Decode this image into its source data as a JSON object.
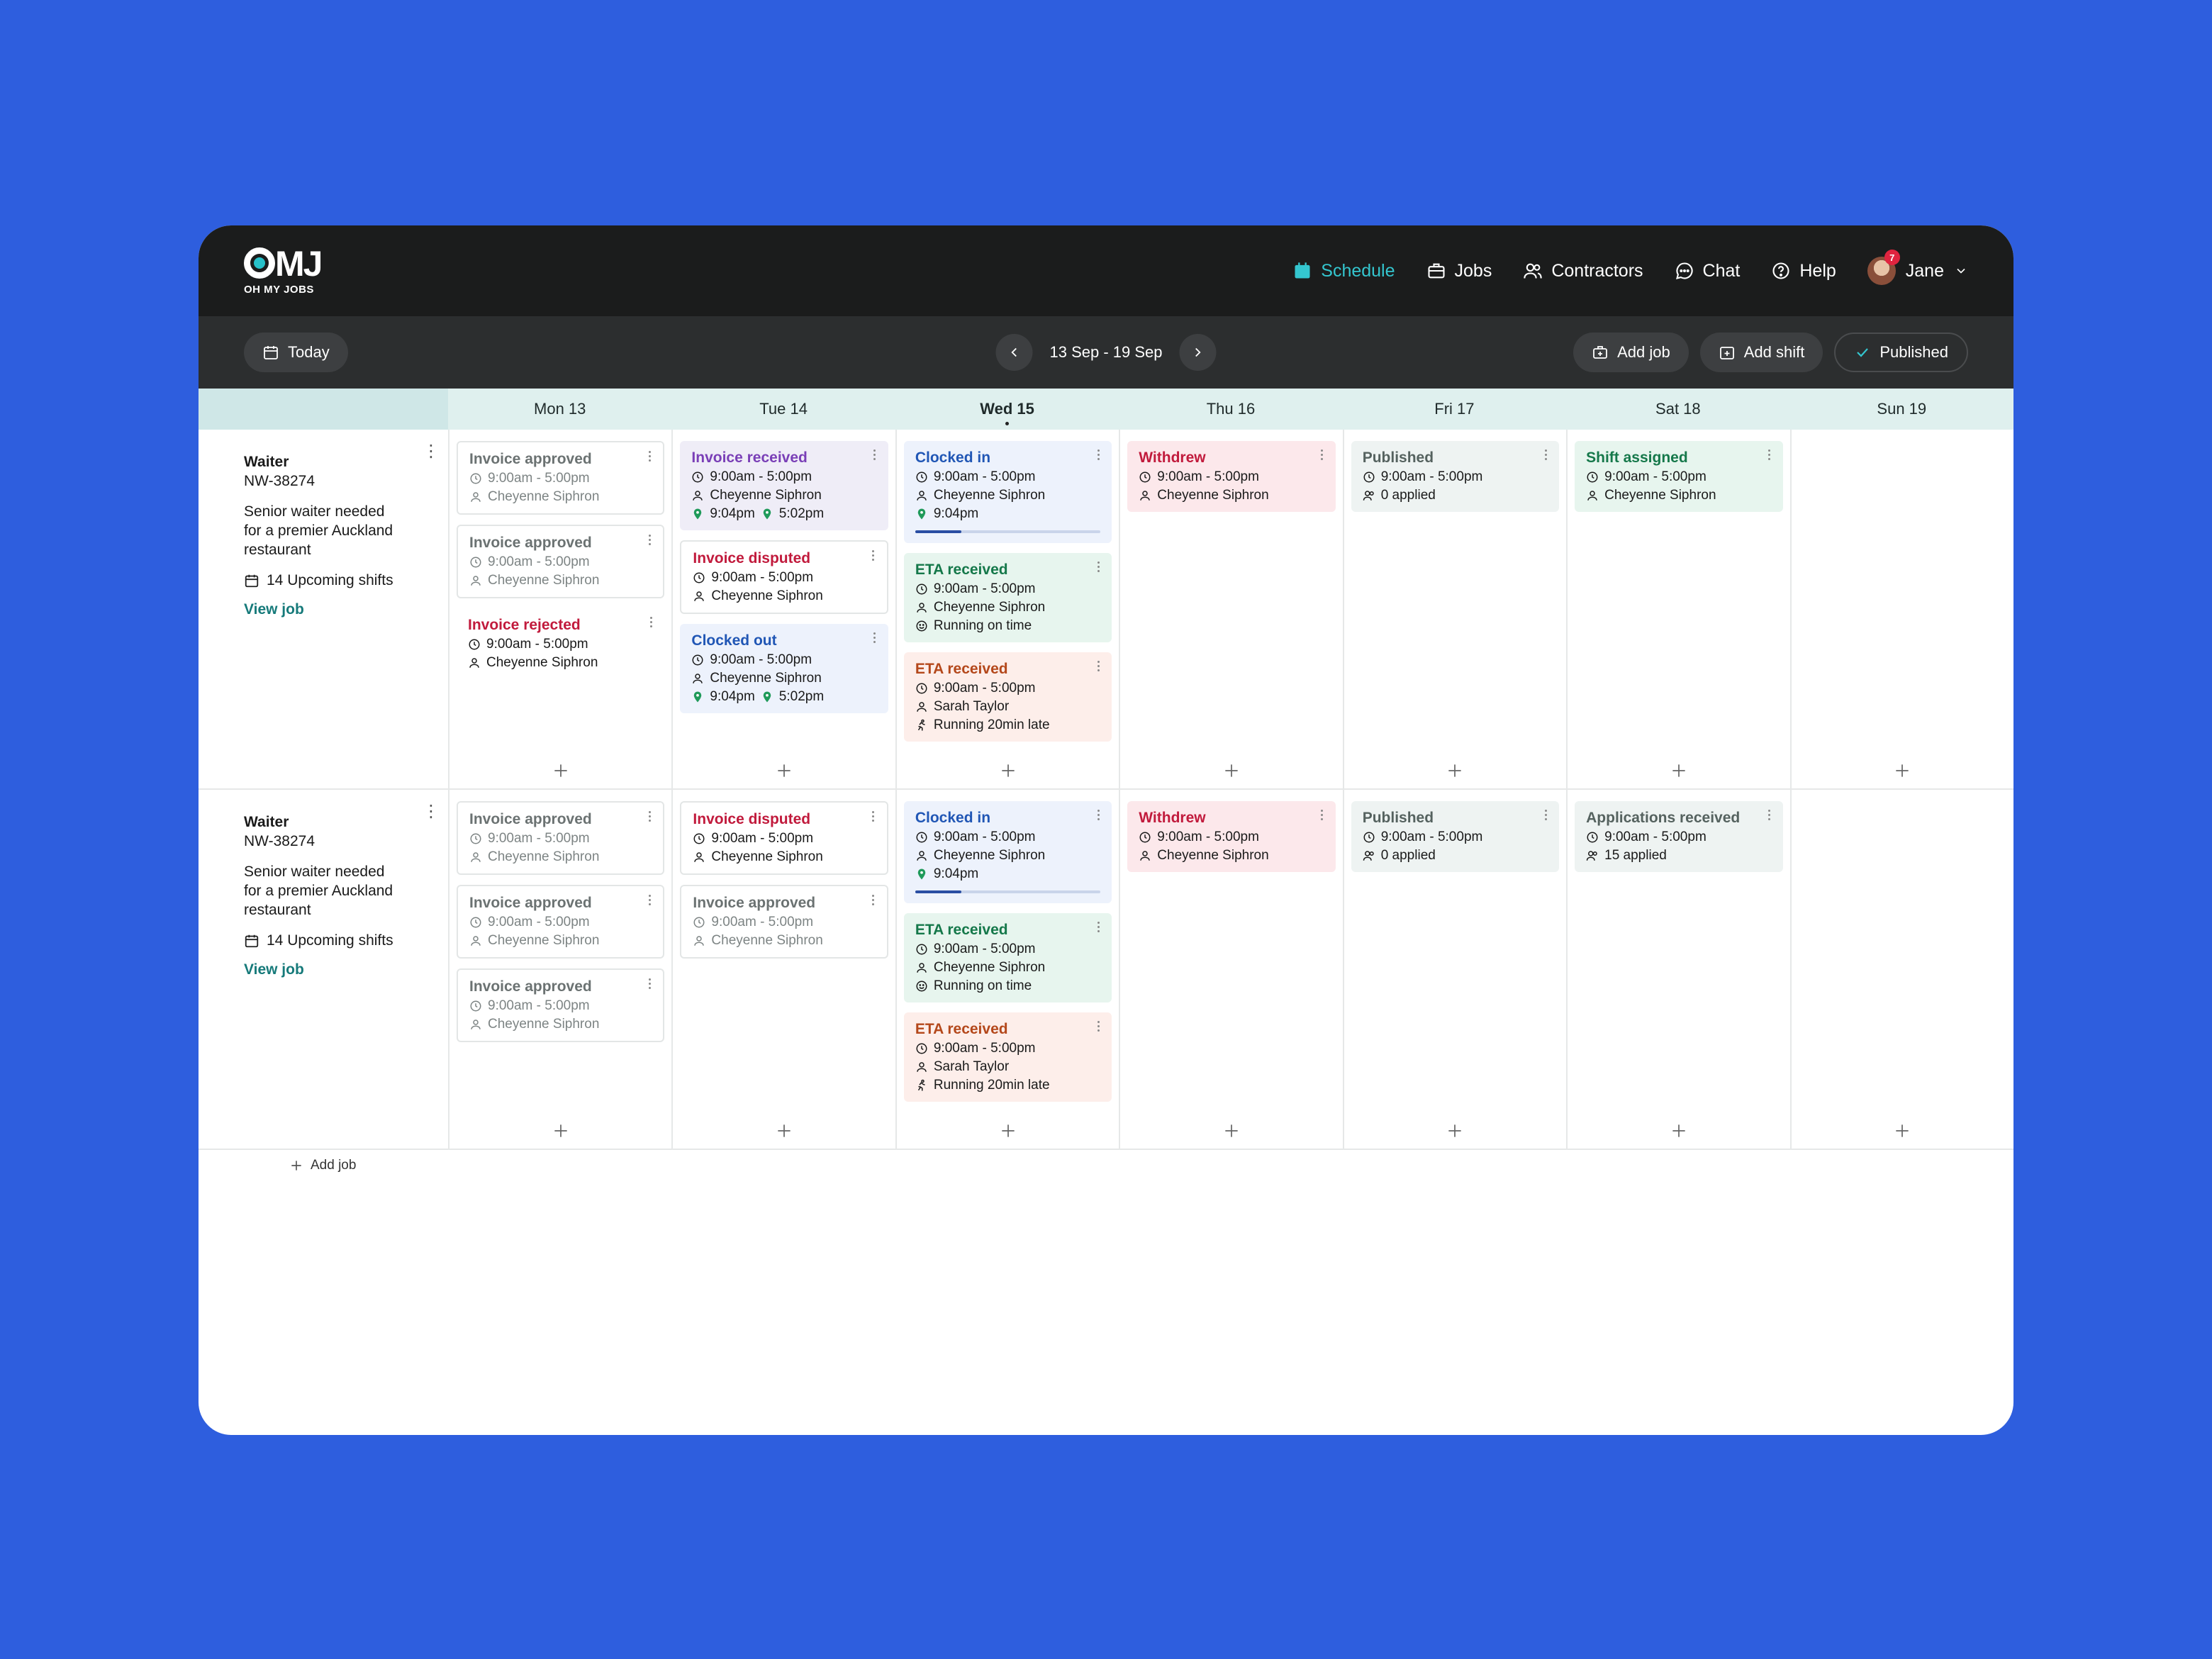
{
  "brand": {
    "logo": "OMJ",
    "tagline": "OH MY JOBS"
  },
  "nav": {
    "schedule": "Schedule",
    "jobs": "Jobs",
    "contractors": "Contractors",
    "chat": "Chat",
    "help": "Help",
    "user": "Jane",
    "notifications": "7"
  },
  "toolbar": {
    "today": "Today",
    "range": "13 Sep - 19 Sep",
    "add_job": "Add job",
    "add_shift": "Add shift",
    "published": "Published"
  },
  "days": [
    "Mon 13",
    "Tue 14",
    "Wed 15",
    "Thu 16",
    "Fri 17",
    "Sat 18",
    "Sun 19"
  ],
  "current_day_index": 2,
  "jobs": [
    {
      "role": "Waiter",
      "code": "NW-38274",
      "desc": "Senior waiter needed for a premier Auckland restaurant",
      "shifts": "14 Upcoming shifts",
      "view": "View job",
      "columns": [
        [
          {
            "style": "grey",
            "status": "Invoice approved",
            "time": "9:00am - 5:00pm",
            "person": "Cheyenne Siphron"
          },
          {
            "style": "grey",
            "status": "Invoice approved",
            "time": "9:00am - 5:00pm",
            "person": "Cheyenne Siphron"
          },
          {
            "style": "red2",
            "status": "Invoice rejected",
            "time": "9:00am - 5:00pm",
            "person": "Cheyenne Siphron"
          }
        ],
        [
          {
            "style": "purple",
            "status": "Invoice received",
            "time": "9:00am - 5:00pm",
            "person": "Cheyenne Siphron",
            "pins": [
              "9:04pm",
              "5:02pm"
            ]
          },
          {
            "style": "white red2",
            "status": "Invoice disputed",
            "time": "9:00am - 5:00pm",
            "person": "Cheyenne Siphron"
          },
          {
            "style": "blue",
            "status": "Clocked out",
            "time": "9:00am - 5:00pm",
            "person": "Cheyenne Siphron",
            "pins": [
              "9:04pm",
              "5:02pm"
            ]
          }
        ],
        [
          {
            "style": "blue",
            "status": "Clocked in",
            "time": "9:00am - 5:00pm",
            "person": "Cheyenne Siphron",
            "pins": [
              "9:04pm"
            ],
            "progress": 0.25
          },
          {
            "style": "green",
            "status": "ETA received",
            "time": "9:00am - 5:00pm",
            "person": "Cheyenne Siphron",
            "note": "Running on time",
            "note_icon": "smile"
          },
          {
            "style": "orange",
            "status": "ETA received",
            "time": "9:00am - 5:00pm",
            "person": "Sarah Taylor",
            "note": "Running 20min late",
            "note_icon": "run"
          }
        ],
        [
          {
            "style": "red",
            "status": "Withdrew",
            "time": "9:00am - 5:00pm",
            "person": "Cheyenne Siphron"
          }
        ],
        [
          {
            "style": "pub",
            "status": "Published",
            "time": "9:00am - 5:00pm",
            "applied": "0 applied"
          }
        ],
        [
          {
            "style": "shift",
            "status": "Shift assigned",
            "time": "9:00am - 5:00pm",
            "person": "Cheyenne Siphron"
          }
        ],
        []
      ]
    },
    {
      "role": "Waiter",
      "code": "NW-38274",
      "desc": "Senior waiter needed for a premier Auckland restaurant",
      "shifts": "14 Upcoming shifts",
      "view": "View job",
      "columns": [
        [
          {
            "style": "grey",
            "status": "Invoice approved",
            "time": "9:00am - 5:00pm",
            "person": "Cheyenne Siphron"
          },
          {
            "style": "grey",
            "status": "Invoice approved",
            "time": "9:00am - 5:00pm",
            "person": "Cheyenne Siphron"
          },
          {
            "style": "grey",
            "status": "Invoice approved",
            "time": "9:00am - 5:00pm",
            "person": "Cheyenne Siphron"
          }
        ],
        [
          {
            "style": "white red2",
            "status": "Invoice disputed",
            "time": "9:00am - 5:00pm",
            "person": "Cheyenne Siphron"
          },
          {
            "style": "grey",
            "status": "Invoice approved",
            "time": "9:00am - 5:00pm",
            "person": "Cheyenne Siphron"
          }
        ],
        [
          {
            "style": "blue",
            "status": "Clocked in",
            "time": "9:00am - 5:00pm",
            "person": "Cheyenne Siphron",
            "pins": [
              "9:04pm"
            ],
            "progress": 0.25
          },
          {
            "style": "green",
            "status": "ETA received",
            "time": "9:00am - 5:00pm",
            "person": "Cheyenne Siphron",
            "note": "Running on time",
            "note_icon": "smile"
          },
          {
            "style": "orange",
            "status": "ETA received",
            "time": "9:00am - 5:00pm",
            "person": "Sarah Taylor",
            "note": "Running 20min late",
            "note_icon": "run"
          }
        ],
        [
          {
            "style": "red",
            "status": "Withdrew",
            "time": "9:00am - 5:00pm",
            "person": "Cheyenne Siphron"
          }
        ],
        [
          {
            "style": "pub",
            "status": "Published",
            "time": "9:00am - 5:00pm",
            "applied": "0 applied"
          }
        ],
        [
          {
            "style": "pub",
            "status": "Applications received",
            "time": "9:00am - 5:00pm",
            "applied": "15 applied"
          }
        ],
        []
      ]
    }
  ],
  "add_job_footer": "Add job"
}
